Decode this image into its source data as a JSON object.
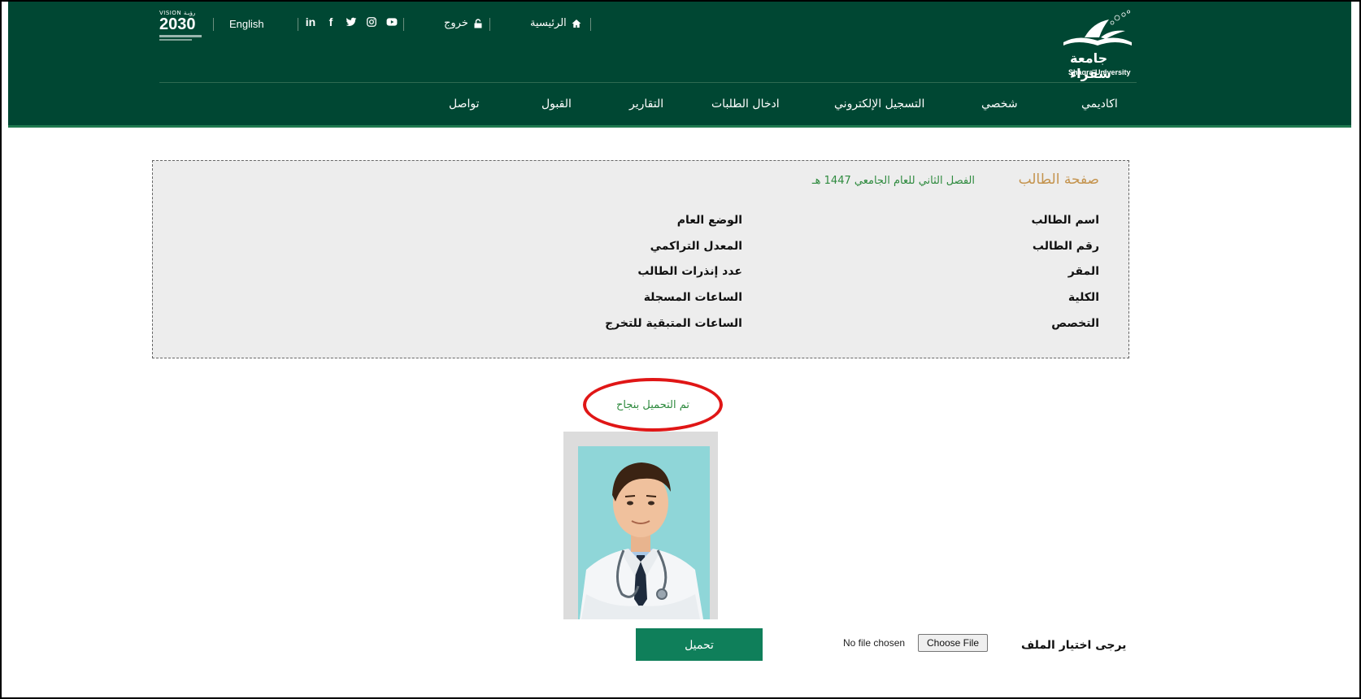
{
  "header": {
    "vision": {
      "top": "VISION رؤيـة",
      "main": "2030"
    },
    "language_link": "English",
    "socials": [
      "linkedin-icon",
      "facebook-icon",
      "twitter-icon",
      "instagram-icon",
      "youtube-icon"
    ],
    "logout_label": "خروج",
    "home_label": "الرئيسية",
    "logo": {
      "arabic": "جامعة شقراء",
      "english": "Shaqra University"
    },
    "nav": [
      "اكاديمي",
      "شخصي",
      "التسجيل الإلكتروني",
      "ادخال الطلبات",
      "التقارير",
      "القبول",
      "تواصل"
    ]
  },
  "student_panel": {
    "title": "صفحة الطالب",
    "semester": "الفصل الثاني للعام الجامعي 1447 هـ",
    "right_fields": [
      "اسم الطالب",
      "رقم الطالب",
      "المقر",
      "الكلية",
      "التخصص"
    ],
    "middle_fields": [
      "الوضع العام",
      "المعدل التراكمي",
      "عدد إنذرات الطالب",
      "الساعات المسجلة",
      "الساعات المتبقية للتخرج"
    ]
  },
  "upload": {
    "success_message": "تم التحميل بنجاح",
    "upload_button": "تحميل",
    "no_file_text": "No file chosen",
    "choose_file_button": "Choose File",
    "file_label": "يرجى اختيار الملف"
  },
  "colors": {
    "header_bg": "#004733",
    "accent_green": "#0f7f5a",
    "title_gold": "#c4934d",
    "success_green": "#2e8a3e",
    "highlight_red": "#e01616"
  }
}
